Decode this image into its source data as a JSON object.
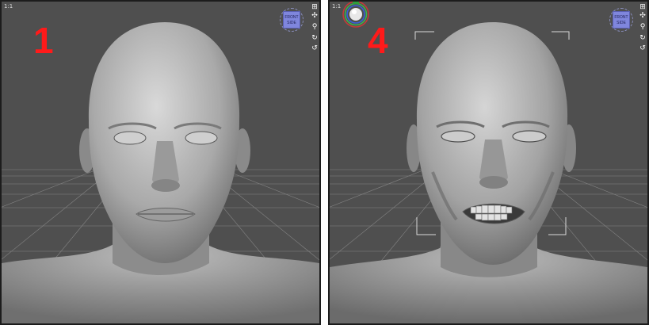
{
  "panels": [
    {
      "label": "1",
      "ratio": "1:1",
      "cube_top": "FRONT",
      "cube_bottom": "SIDE",
      "tools": {
        "lock": "⊞",
        "move": "✣",
        "zoom": "⚲",
        "orbit": "↻",
        "fit": "↺"
      }
    },
    {
      "label": "4",
      "ratio": "1:1",
      "cube_top": "FRONT",
      "cube_bottom": "SIDE",
      "tools": {
        "lock": "⊞",
        "move": "✣",
        "zoom": "⚲",
        "orbit": "↻",
        "fit": "↺"
      }
    }
  ],
  "colors": {
    "background": "#4f4f4f",
    "label_red": "#ff1a1a",
    "cube_blue": "#7f86dd",
    "grid_line": "#9a9a9a"
  }
}
